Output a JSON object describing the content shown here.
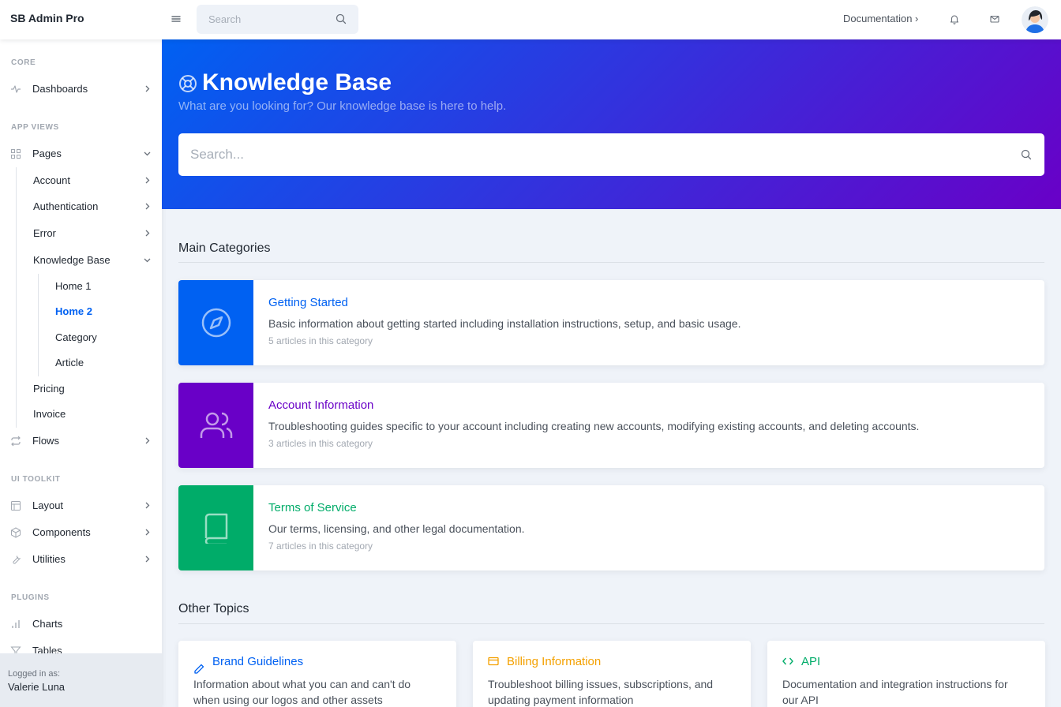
{
  "app": {
    "brand": "SB Admin Pro"
  },
  "topbar": {
    "search_placeholder": "Search",
    "documentation_label": "Documentation ›"
  },
  "sidebar": {
    "sections": [
      {
        "heading": "CORE"
      },
      {
        "heading": "APP VIEWS"
      },
      {
        "heading": "UI TOOLKIT"
      },
      {
        "heading": "PLUGINS"
      }
    ],
    "items": {
      "dashboards": "Dashboards",
      "pages": "Pages",
      "account": "Account",
      "authentication": "Authentication",
      "error": "Error",
      "knowledge_base": "Knowledge Base",
      "home1": "Home 1",
      "home2": "Home 2",
      "category": "Category",
      "article": "Article",
      "pricing": "Pricing",
      "invoice": "Invoice",
      "flows": "Flows",
      "layout": "Layout",
      "components": "Components",
      "utilities": "Utilities",
      "charts": "Charts",
      "tables": "Tables"
    },
    "footer": {
      "caption": "Logged in as:",
      "user": "Valerie Luna"
    }
  },
  "header": {
    "title": "Knowledge Base",
    "subtitle": "What are you looking for? Our knowledge base is here to help.",
    "search_placeholder": "Search..."
  },
  "main": {
    "categories_heading": "Main Categories",
    "categories": [
      {
        "title": "Getting Started",
        "description": "Basic information about getting started including installation instructions, setup, and basic usage.",
        "count": "5 articles in this category",
        "color": "#0061f2",
        "icon": "compass-icon"
      },
      {
        "title": "Account Information",
        "description": "Troubleshooting guides specific to your account including creating new accounts, modifying existing accounts, and deleting accounts.",
        "count": "3 articles in this category",
        "color": "#6900c7",
        "icon": "users-icon"
      },
      {
        "title": "Terms of Service",
        "description": "Our terms, licensing, and other legal documentation.",
        "count": "7 articles in this category",
        "color": "#00ac69",
        "icon": "book-icon"
      }
    ],
    "topics_heading": "Other Topics",
    "topics": [
      {
        "title": "Brand Guidelines",
        "description": "Information about what you can and can't do when using our logos and other assets",
        "color": "#0061f2",
        "icon": "pen-icon"
      },
      {
        "title": "Billing Information",
        "description": "Troubleshoot billing issues, subscriptions, and updating payment information",
        "color": "#f4a100",
        "icon": "credit-card-icon"
      },
      {
        "title": "API",
        "description": "Documentation and integration instructions for our API",
        "color": "#00ac69",
        "icon": "code-icon"
      }
    ]
  }
}
